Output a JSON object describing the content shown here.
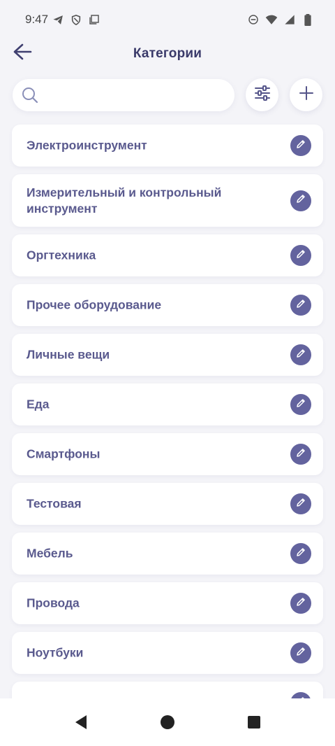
{
  "status_bar": {
    "time": "9:47",
    "left_icons": [
      "telegram-icon",
      "vpn-shield-icon",
      "screenshot-icon"
    ],
    "right_icons": [
      "do-not-disturb-icon",
      "wifi-icon",
      "signal-icon",
      "battery-icon"
    ]
  },
  "header": {
    "title": "Категории"
  },
  "search": {
    "placeholder": "",
    "value": ""
  },
  "colors": {
    "accent": "#63639e",
    "text": "#5a5a8e",
    "background": "#f4f4f8"
  },
  "categories": [
    {
      "label": "Электроинструмент"
    },
    {
      "label": "Измерительный и контрольный инструмент"
    },
    {
      "label": "Оргтехника"
    },
    {
      "label": "Прочее оборудование"
    },
    {
      "label": "Личные вещи"
    },
    {
      "label": "Еда"
    },
    {
      "label": "Смартфоны"
    },
    {
      "label": "Тестовая"
    },
    {
      "label": "Мебель"
    },
    {
      "label": "Провода"
    },
    {
      "label": "Ноутбуки"
    },
    {
      "label": ""
    }
  ]
}
